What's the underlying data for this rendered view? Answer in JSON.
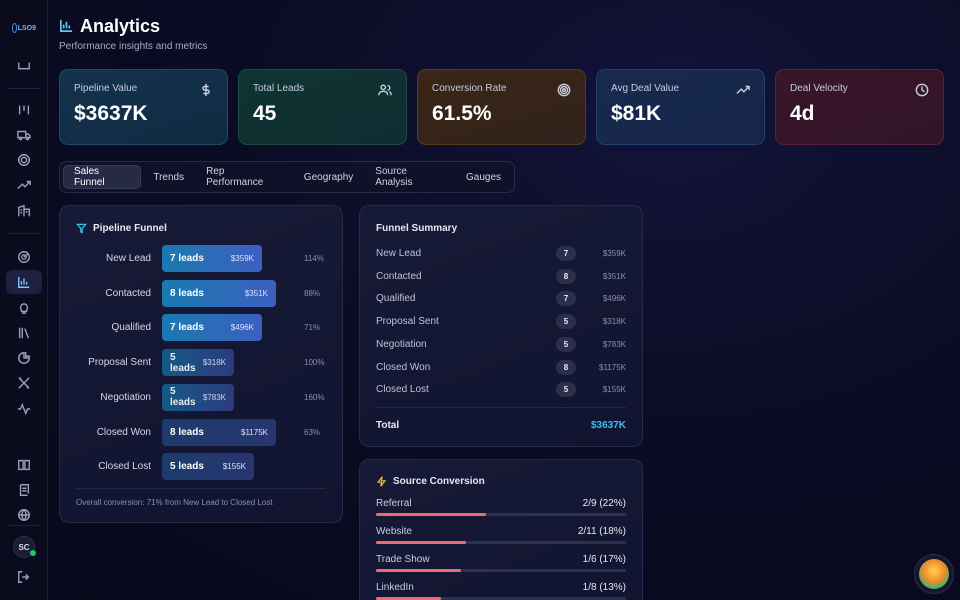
{
  "sidebar": {
    "logo_text": "LSO9",
    "icons": [
      "inbox-icon",
      "columns-icon",
      "truck-icon",
      "target-icon",
      "trending-icon",
      "building-icon",
      "radar-icon",
      "chart-icon",
      "lightbulb-icon",
      "library-icon",
      "pie-icon",
      "tools-icon",
      "activity-icon",
      "book-icon",
      "scroll-icon",
      "globe-icon"
    ],
    "avatar_initials": "SC"
  },
  "header": {
    "title": "Analytics",
    "subtitle": "Performance insights and metrics"
  },
  "kpis": [
    {
      "label": "Pipeline Value",
      "value": "$3637K",
      "icon": "dollar-icon",
      "bg": "#13324c",
      "border": "#1f4a66"
    },
    {
      "label": "Total Leads",
      "value": "45",
      "icon": "users-icon",
      "bg": "#0f3432",
      "border": "#1b4e44"
    },
    {
      "label": "Conversion Rate",
      "value": "61.5%",
      "icon": "target-icon",
      "bg": "#3a2616",
      "border": "#5a3a1f"
    },
    {
      "label": "Avg Deal Value",
      "value": "$81K",
      "icon": "trending-up-icon",
      "bg": "#172a4e",
      "border": "#243f6e"
    },
    {
      "label": "Deal Velocity",
      "value": "4d",
      "icon": "clock-icon",
      "bg": "#3a1528",
      "border": "#5a2140"
    }
  ],
  "tabs": [
    {
      "label": "Sales Funnel",
      "active": true
    },
    {
      "label": "Trends",
      "active": false
    },
    {
      "label": "Rep Performance",
      "active": false
    },
    {
      "label": "Geography",
      "active": false
    },
    {
      "label": "Source Analysis",
      "active": false
    },
    {
      "label": "Gauges",
      "active": false
    }
  ],
  "funnel": {
    "title": "Pipeline Funnel",
    "rows": [
      {
        "stage": "New Lead",
        "leads": "7 leads",
        "amount": "$359K",
        "pct": "114%",
        "share": 0.78
      },
      {
        "stage": "Contacted",
        "leads": "8 leads",
        "amount": "$351K",
        "pct": "88%",
        "share": 0.89
      },
      {
        "stage": "Qualified",
        "leads": "7 leads",
        "amount": "$496K",
        "pct": "71%",
        "share": 0.78
      },
      {
        "stage": "Proposal Sent",
        "leads": "5 leads",
        "amount": "$318K",
        "pct": "100%",
        "share": 0.56
      },
      {
        "stage": "Negotiation",
        "leads": "5 leads",
        "amount": "$783K",
        "pct": "160%",
        "share": 0.56
      },
      {
        "stage": "Closed Won",
        "leads": "8 leads",
        "amount": "$1175K",
        "pct": "63%",
        "share": 0.89
      },
      {
        "stage": "Closed Lost",
        "leads": "5 leads",
        "amount": "$155K",
        "pct": "",
        "share": 0.72
      }
    ],
    "footer": "Overall conversion: 71% from New Lead to Closed Lost"
  },
  "summary": {
    "title": "Funnel Summary",
    "rows": [
      {
        "stage": "New Lead",
        "count": "7",
        "amount": "$359K"
      },
      {
        "stage": "Contacted",
        "count": "8",
        "amount": "$351K"
      },
      {
        "stage": "Qualified",
        "count": "7",
        "amount": "$496K"
      },
      {
        "stage": "Proposal Sent",
        "count": "5",
        "amount": "$318K"
      },
      {
        "stage": "Negotiation",
        "count": "5",
        "amount": "$783K"
      },
      {
        "stage": "Closed Won",
        "count": "8",
        "amount": "$1175K"
      },
      {
        "stage": "Closed Lost",
        "count": "5",
        "amount": "$155K"
      }
    ],
    "total_label": "Total",
    "total_value": "$3637K"
  },
  "source_conversion": {
    "title": "Source Conversion",
    "rows": [
      {
        "source": "Referral",
        "value": "2/9 (22%)",
        "rate": 0.22
      },
      {
        "source": "Website",
        "value": "2/11 (18%)",
        "rate": 0.18
      },
      {
        "source": "Trade Show",
        "value": "1/6 (17%)",
        "rate": 0.17
      },
      {
        "source": "LinkedIn",
        "value": "1/8 (13%)",
        "rate": 0.13
      }
    ]
  }
}
